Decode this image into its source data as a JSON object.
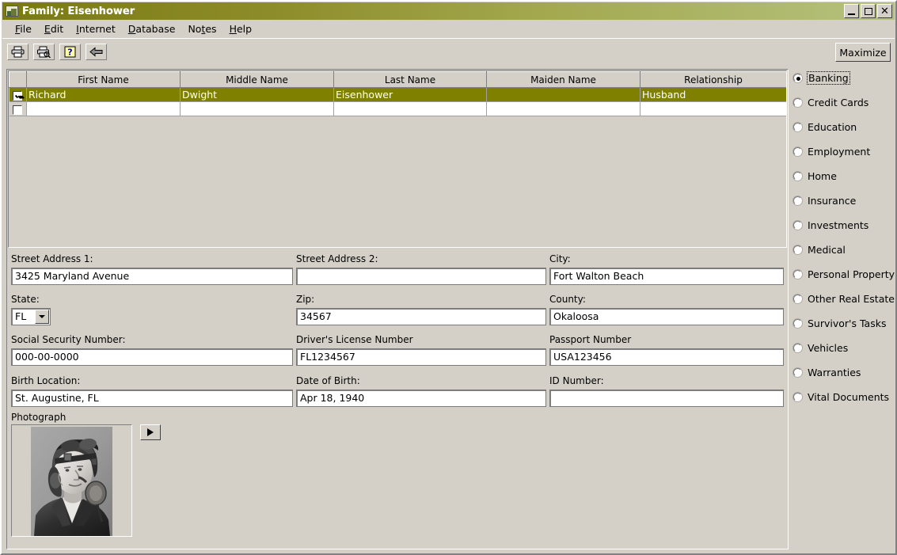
{
  "window": {
    "title": "Family: Eisenhower",
    "icon": "app-icon",
    "controls": {
      "minimize": "minimize",
      "maximize": "maximize",
      "close": "close"
    }
  },
  "menu": {
    "items": [
      {
        "label": "File",
        "accel": "F"
      },
      {
        "label": "Edit",
        "accel": "E"
      },
      {
        "label": "Internet",
        "accel": "I"
      },
      {
        "label": "Database",
        "accel": "D"
      },
      {
        "label": "Notes",
        "accel": "t"
      },
      {
        "label": "Help",
        "accel": "H"
      }
    ]
  },
  "toolbar": {
    "buttons": [
      {
        "name": "print-button",
        "icon": "printer-icon"
      },
      {
        "name": "print-preview-button",
        "icon": "print-preview-icon"
      },
      {
        "name": "help-button",
        "icon": "question-mark-icon"
      },
      {
        "name": "back-button",
        "icon": "left-arrow-icon"
      }
    ],
    "maximize_label": "Maximize"
  },
  "grid": {
    "columns": [
      "First Name",
      "Middle Name",
      "Last Name",
      "Maiden Name",
      "Relationship"
    ],
    "rows": [
      {
        "checked": true,
        "selected": true,
        "first_name": "Richard",
        "middle_name": "Dwight",
        "last_name": "Eisenhower",
        "maiden_name": "",
        "relationship": "Husband"
      },
      {
        "checked": false,
        "selected": false,
        "first_name": "",
        "middle_name": "",
        "last_name": "",
        "maiden_name": "",
        "relationship": ""
      }
    ]
  },
  "form": {
    "street_address_1": {
      "label": "Street Address 1:",
      "value": "3425 Maryland Avenue"
    },
    "street_address_2": {
      "label": "Street Address 2:",
      "value": ""
    },
    "city": {
      "label": "City:",
      "value": "Fort Walton Beach"
    },
    "state": {
      "label": "State:",
      "value": "FL"
    },
    "zip": {
      "label": "Zip:",
      "value": "34567"
    },
    "county": {
      "label": "County:",
      "value": "Okaloosa"
    },
    "ssn": {
      "label": "Social Security Number:",
      "value": "000-00-0000"
    },
    "drivers_license": {
      "label": "Driver's License Number",
      "value": "FL1234567"
    },
    "passport": {
      "label": "Passport Number",
      "value": "USA123456"
    },
    "birth_location": {
      "label": "Birth Location:",
      "value": "St. Augustine, FL"
    },
    "date_of_birth": {
      "label": "Date of Birth:",
      "value": "Apr 18, 1940"
    },
    "id_number": {
      "label": "ID Number:",
      "value": ""
    },
    "photograph": {
      "label": "Photograph",
      "alt": "black and white portrait of a man in a leather flight helmet with goggles"
    }
  },
  "categories": {
    "selected": "Banking",
    "items": [
      {
        "label": "Banking",
        "selected": true
      },
      {
        "label": "Credit Cards",
        "selected": false
      },
      {
        "label": "Education",
        "selected": false
      },
      {
        "label": "Employment",
        "selected": false
      },
      {
        "label": "Home",
        "selected": false
      },
      {
        "label": "Insurance",
        "selected": false
      },
      {
        "label": "Investments",
        "selected": false
      },
      {
        "label": "Medical",
        "selected": false
      },
      {
        "label": "Personal Property",
        "selected": false
      },
      {
        "label": "Other Real Estate",
        "selected": false
      },
      {
        "label": "Survivor's Tasks",
        "selected": false
      },
      {
        "label": "Vehicles",
        "selected": false
      },
      {
        "label": "Warranties",
        "selected": false
      },
      {
        "label": "Vital Documents",
        "selected": false
      }
    ]
  },
  "colors": {
    "title_gradient_start": "#7a7a12",
    "title_gradient_end": "#b5c27e",
    "selection": "#808000",
    "face": "#d4d0c8",
    "field": "#ffffff"
  }
}
